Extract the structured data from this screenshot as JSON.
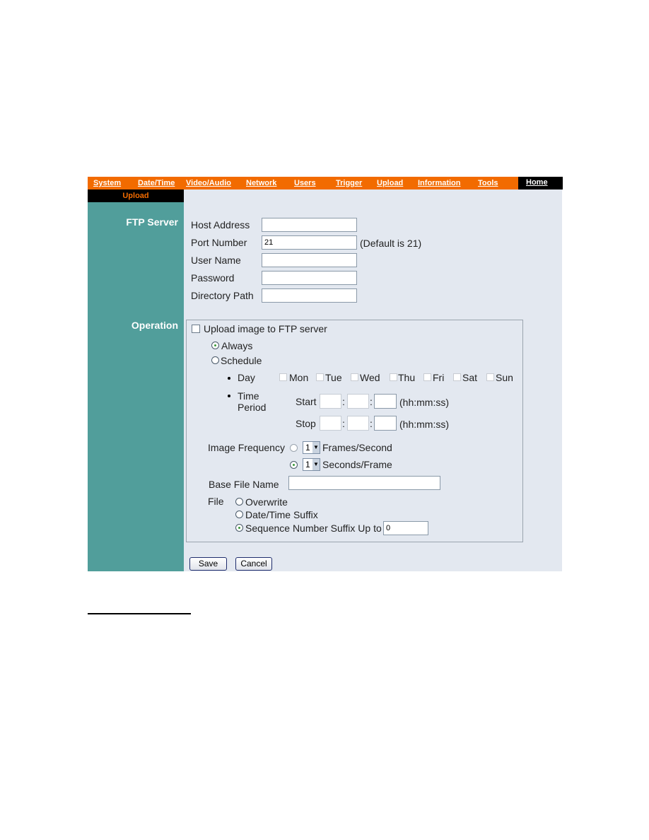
{
  "nav": {
    "items": [
      "System",
      "Date/Time",
      "Video/Audio",
      "Network",
      "Users",
      "Trigger",
      "Upload",
      "Information",
      "Tools"
    ],
    "home": "Home"
  },
  "submenu": {
    "active": "Upload"
  },
  "sections": {
    "ftp": "FTP Server",
    "operation": "Operation"
  },
  "ftp": {
    "host_label": "Host Address",
    "host_value": "",
    "port_label": "Port Number",
    "port_value": "21",
    "port_hint": "(Default is 21)",
    "user_label": "User Name",
    "user_value": "",
    "password_label": "Password",
    "password_value": "",
    "dir_label": "Directory Path",
    "dir_value": ""
  },
  "operation": {
    "upload_label": "Upload image to FTP server",
    "upload_checked": false,
    "always": "Always",
    "schedule": "Schedule",
    "selected_mode": "Always",
    "day_label": "Day",
    "days": [
      "Mon",
      "Tue",
      "Wed",
      "Thu",
      "Fri",
      "Sat",
      "Sun"
    ],
    "time_label_1": "Time",
    "time_label_2": "Period",
    "start": "Start",
    "stop": "Stop",
    "time_format": "(hh:mm:ss)",
    "freq_label": "Image Frequency",
    "fps_value": "1",
    "fps_unit": "Frames/Second",
    "spf_value": "1",
    "spf_unit": "Seconds/Frame",
    "freq_selected": "Seconds/Frame",
    "base_label": "Base File Name",
    "base_value": "",
    "file_label": "File",
    "overwrite": "Overwrite",
    "datetime": "Date/Time Suffix",
    "sequence": "Sequence Number Suffix Up to",
    "sequence_value": "0",
    "file_selected": "Sequence Number Suffix Up to"
  },
  "buttons": {
    "save": "Save",
    "cancel": "Cancel"
  },
  "colors": {
    "nav": "#f26b00",
    "sidebar": "#519e9b",
    "content": "#e3e8f0"
  }
}
